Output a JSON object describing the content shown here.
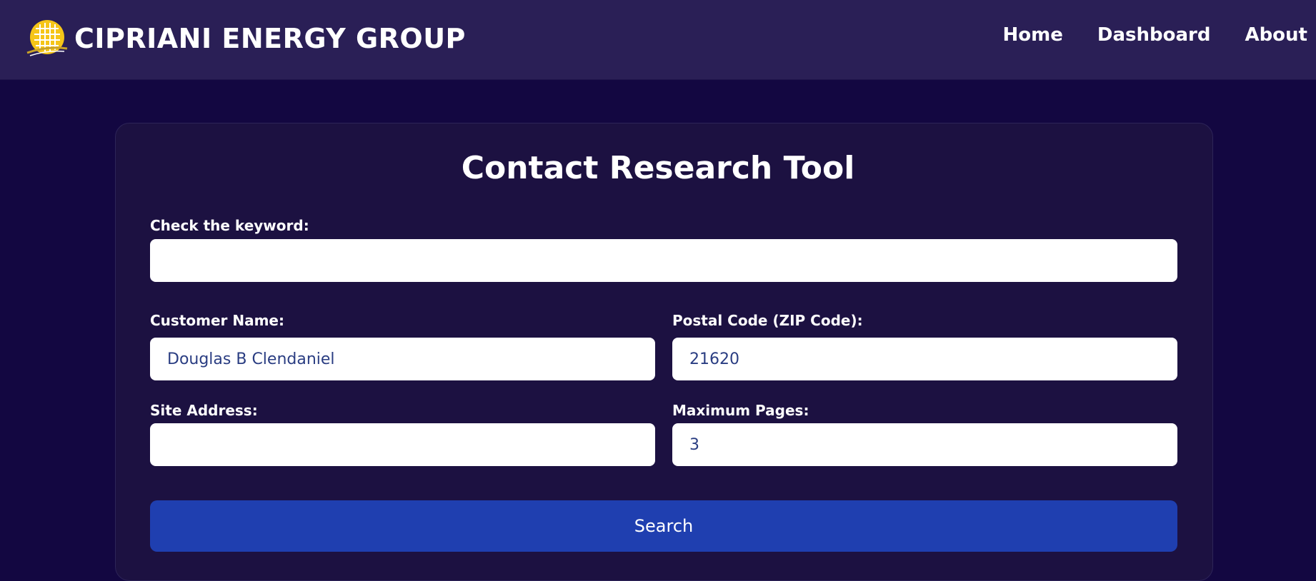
{
  "brand": {
    "name": "CIPRIANI ENERGY GROUP",
    "logo_icon": "solar-panel-sun-icon",
    "logo_color": "#f5c518"
  },
  "nav": {
    "items": [
      {
        "label": "Home"
      },
      {
        "label": "Dashboard"
      },
      {
        "label": "About"
      }
    ]
  },
  "form": {
    "title": "Contact Research Tool",
    "keyword": {
      "label": "Check the keyword:",
      "value": ""
    },
    "customer_name": {
      "label": "Customer Name:",
      "value": "Douglas B Clendaniel"
    },
    "postal_code": {
      "label": "Postal Code (ZIP Code):",
      "value": "21620"
    },
    "site_address": {
      "label": "Site Address:",
      "value": ""
    },
    "max_pages": {
      "label": "Maximum Pages:",
      "value": "3"
    },
    "search_label": "Search"
  },
  "colors": {
    "background": "#130741",
    "navbar": "#2a1f56",
    "card": "#1c1141",
    "button": "#1f3fb0",
    "input_text": "#2a3d82"
  }
}
